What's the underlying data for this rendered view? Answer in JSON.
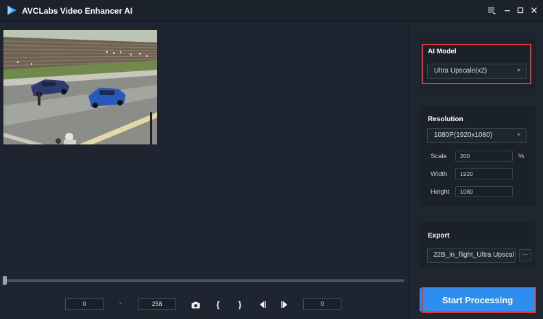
{
  "app": {
    "title": "AVCLabs Video Enhancer AI"
  },
  "window_controls": [
    "menu-icon",
    "minimize-icon",
    "maximize-icon",
    "close-icon"
  ],
  "player": {
    "start_frame": "0",
    "separator": "-",
    "end_frame": "258",
    "current_frame": "0",
    "progress": 0.0,
    "controls": [
      "camera-icon",
      "mark-in-icon",
      "mark-out-icon",
      "prev-frame-icon",
      "next-frame-icon"
    ],
    "mark_in_glyph": "{",
    "mark_out_glyph": "}"
  },
  "ai_model": {
    "title": "AI Model",
    "selected": "Ultra Upscale(x2)"
  },
  "resolution": {
    "title": "Resolution",
    "selected": "1080P(1920x1080)",
    "scale_label": "Scale",
    "scale_value": "200",
    "scale_unit": "%",
    "width_label": "Width",
    "width_value": "1920",
    "height_label": "Height",
    "height_value": "1080"
  },
  "export": {
    "title": "Export",
    "filename": "22B_in_flight_Ultra Upscal",
    "more_label": "···"
  },
  "actions": {
    "start_label": "Start Processing"
  },
  "colors": {
    "accent": "#2e8ef0",
    "highlight": "#e0363a",
    "background": "#1f2630",
    "panel": "#1b212a"
  }
}
